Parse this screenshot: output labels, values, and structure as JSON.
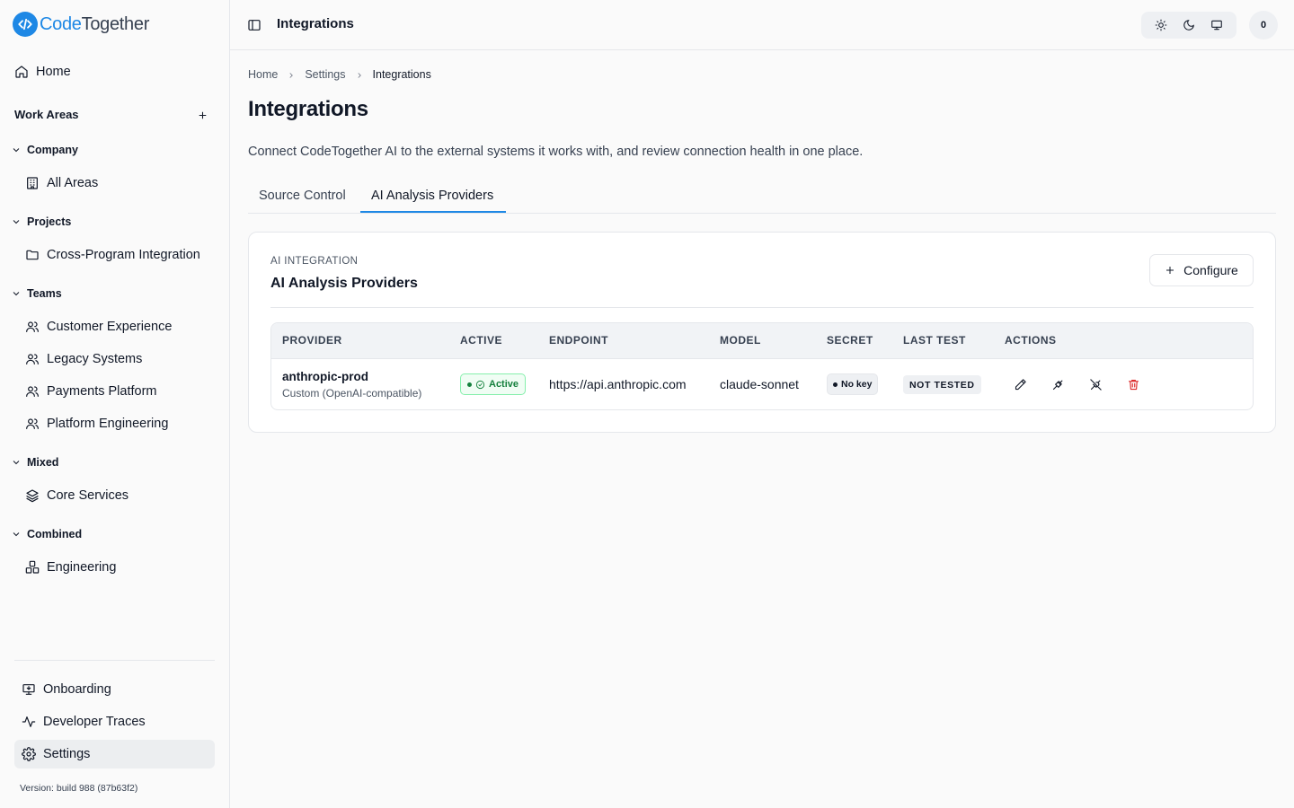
{
  "app": {
    "logo_text_brand": "Code",
    "logo_text_rest": "Together",
    "version": "Version: build 988 (87b63f2)"
  },
  "sidebar": {
    "home": "Home",
    "work_areas": "Work Areas",
    "groups": [
      {
        "label": "Company",
        "items": [
          {
            "label": "All Areas",
            "icon": "building-icon"
          }
        ]
      },
      {
        "label": "Projects",
        "items": [
          {
            "label": "Cross-Program Integration",
            "icon": "folder-icon"
          }
        ]
      },
      {
        "label": "Teams",
        "items": [
          {
            "label": "Customer Experience",
            "icon": "users-icon"
          },
          {
            "label": "Legacy Systems",
            "icon": "users-icon"
          },
          {
            "label": "Payments Platform",
            "icon": "users-icon"
          },
          {
            "label": "Platform Engineering",
            "icon": "users-icon"
          }
        ]
      },
      {
        "label": "Mixed",
        "items": [
          {
            "label": "Core Services",
            "icon": "layers-icon"
          }
        ]
      },
      {
        "label": "Combined",
        "items": [
          {
            "label": "Engineering",
            "icon": "boxes-icon"
          }
        ]
      }
    ],
    "bottom": {
      "onboarding": "Onboarding",
      "developer_traces": "Developer Traces",
      "settings": "Settings"
    }
  },
  "header": {
    "title": "Integrations",
    "avatar_initial": "0"
  },
  "breadcrumb": [
    "Home",
    "Settings",
    "Integrations"
  ],
  "page": {
    "title": "Integrations",
    "description": "Connect CodeTogether AI to the external systems it works with, and review connection health in one place."
  },
  "tabs": [
    {
      "label": "Source Control",
      "active": false
    },
    {
      "label": "AI Analysis Providers",
      "active": true
    }
  ],
  "card": {
    "eyebrow": "AI INTEGRATION",
    "title": "AI Analysis Providers",
    "configure_label": "Configure"
  },
  "table": {
    "columns": [
      "PROVIDER",
      "ACTIVE",
      "ENDPOINT",
      "MODEL",
      "SECRET",
      "LAST TEST",
      "ACTIONS"
    ],
    "rows": [
      {
        "provider": "anthropic-prod",
        "provider_type": "Custom (OpenAI-compatible)",
        "active": "Active",
        "endpoint": "https://api.anthropic.com",
        "model": "claude-sonnet",
        "secret": "No key",
        "last_test": "NOT TESTED"
      }
    ]
  },
  "colors": {
    "brand": "#1e88e5",
    "active_green": "#15803d",
    "danger": "#dc2626"
  }
}
